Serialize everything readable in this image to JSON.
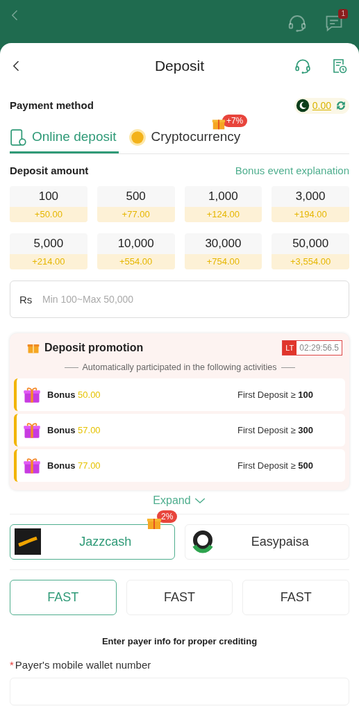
{
  "background": {
    "badge": "1"
  },
  "header": {
    "title": "Deposit"
  },
  "payment_method": {
    "label": "Payment method",
    "balance": "0.00"
  },
  "tabs": [
    {
      "label": "Online deposit",
      "selected": true
    },
    {
      "label": "Cryptocurrency",
      "selected": false,
      "badge": "+7%"
    }
  ],
  "deposit_amount": {
    "label": "Deposit amount",
    "link": "Bonus event explanation",
    "options": [
      {
        "amount": "100",
        "bonus": "+50.00"
      },
      {
        "amount": "500",
        "bonus": "+77.00"
      },
      {
        "amount": "1,000",
        "bonus": "+124.00"
      },
      {
        "amount": "3,000",
        "bonus": "+194.00"
      },
      {
        "amount": "5,000",
        "bonus": "+214.00"
      },
      {
        "amount": "10,000",
        "bonus": "+554.00"
      },
      {
        "amount": "30,000",
        "bonus": "+754.00"
      },
      {
        "amount": "50,000",
        "bonus": "+3,554.00"
      }
    ],
    "currency": "Rs",
    "placeholder": "Min 100~Max 50,000"
  },
  "promotion": {
    "title": "Deposit promotion",
    "timer_tag": "LT",
    "timer": "02:29:56.5",
    "subtitle": "Automatically participated in the following activities",
    "items": [
      {
        "label": "Bonus",
        "amount": "50.00",
        "condition": "First Deposit ≥",
        "threshold": "100"
      },
      {
        "label": "Bonus",
        "amount": "57.00",
        "condition": "First Deposit ≥",
        "threshold": "300"
      },
      {
        "label": "Bonus",
        "amount": "77.00",
        "condition": "First Deposit ≥",
        "threshold": "500"
      }
    ],
    "expand": "Expand"
  },
  "methods": [
    {
      "name": "Jazzcash",
      "selected": true,
      "badge": "2%",
      "kind": "dark"
    },
    {
      "name": "Easypaisa",
      "selected": false,
      "kind": "ring"
    }
  ],
  "channels": [
    {
      "label": "FAST",
      "selected": true
    },
    {
      "label": "FAST",
      "selected": false
    },
    {
      "label": "FAST",
      "selected": false
    }
  ],
  "payer_info": {
    "note": "Enter payer info for proper crediting",
    "required_mark": "*",
    "label": "Payer's mobile wallet number"
  }
}
